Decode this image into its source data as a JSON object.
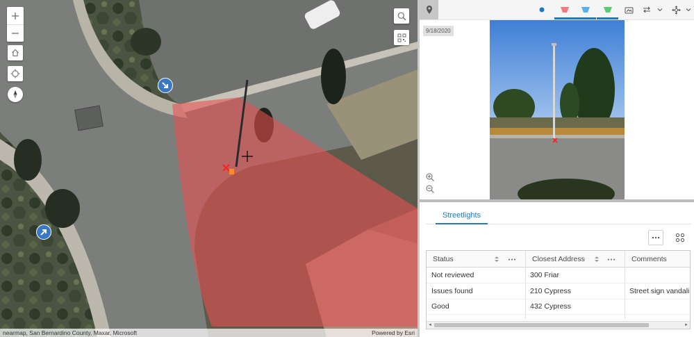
{
  "map": {
    "attribution_left": "nearmap, San Bernardino County, Maxar, Microsoft",
    "attribution_right": "Powered by Esri",
    "icons": {
      "zoom_in": "plus-icon",
      "zoom_out": "minus-icon",
      "home": "home-icon",
      "locate": "crosshair-icon",
      "compass": "compass-icon",
      "search": "search-icon",
      "qr": "qr-code-icon"
    },
    "colors": {
      "view_cone": "#e8504f",
      "marker": "#3a78c4"
    }
  },
  "toolbar": {
    "items": [
      {
        "icon": "map-pin-icon"
      },
      {
        "icon": "blue-dot-icon",
        "color": "#1f79c6"
      },
      {
        "icon": "red-cone-icon",
        "color": "#f47a7a",
        "active": true
      },
      {
        "icon": "blue-cone-icon",
        "color": "#5aaeea",
        "active": true
      },
      {
        "icon": "green-cone-icon",
        "color": "#5ccb72",
        "active": true
      },
      {
        "icon": "street-view-icon"
      },
      {
        "icon": "swap-icon"
      },
      {
        "icon": "chevron-down-icon"
      },
      {
        "icon": "move-icon"
      },
      {
        "icon": "chevron-down-icon"
      }
    ]
  },
  "photo": {
    "date": "9/18/2020",
    "zoom_in_icon": "zoom-in-icon",
    "zoom_out_icon": "zoom-out-icon"
  },
  "table": {
    "tab_label": "Streetlights",
    "options_icon": "more-icon",
    "layout_icon": "grid-icon",
    "columns": [
      "Status",
      "Closest Address",
      "Comments"
    ],
    "rows": [
      [
        "Not reviewed",
        "300 Friar",
        ""
      ],
      [
        "Issues found",
        "210 Cypress",
        "Street sign vandali"
      ],
      [
        "Good",
        "432 Cypress",
        ""
      ]
    ]
  }
}
